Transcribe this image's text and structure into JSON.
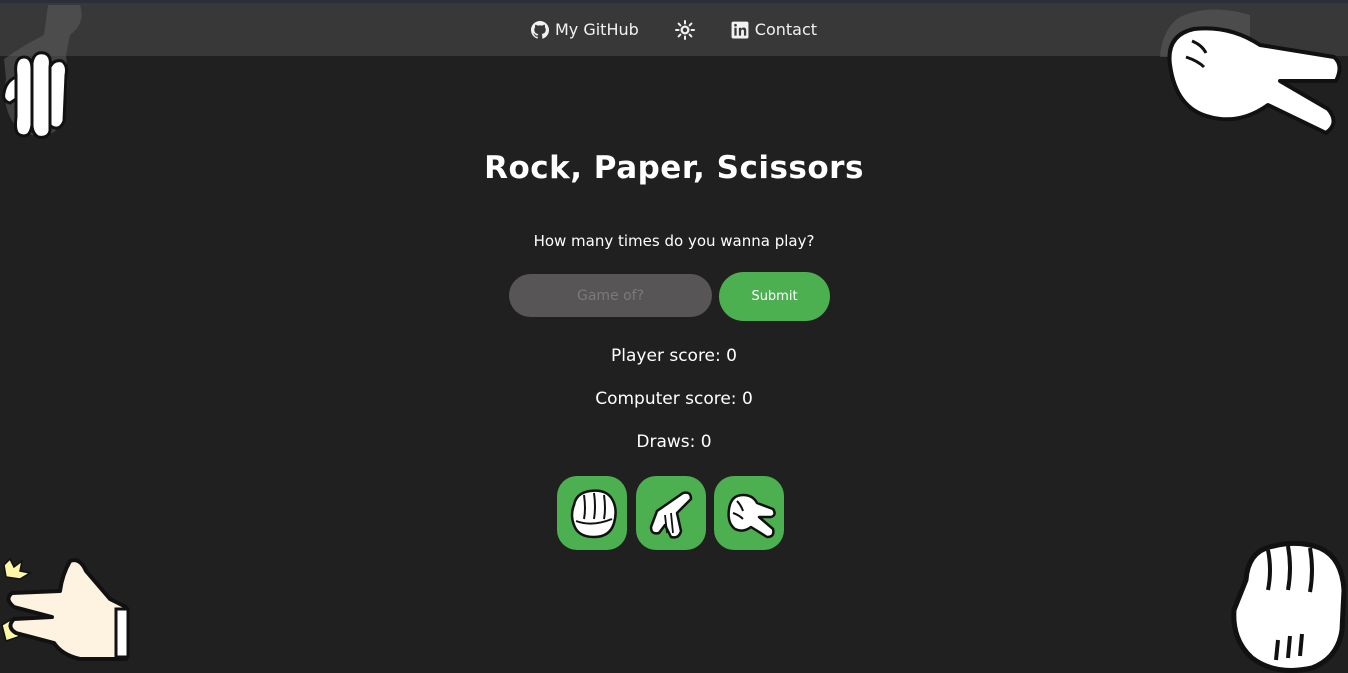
{
  "nav": {
    "github_label": "My GitHub",
    "contact_label": "Contact",
    "github_icon": "github-icon",
    "theme_icon": "sun-icon",
    "contact_icon": "linkedin-icon"
  },
  "game": {
    "title": "Rock, Paper, Scissors",
    "prompt": "How many times do you wanna play?",
    "input_placeholder": "Game of?",
    "input_value": "",
    "submit_label": "Submit"
  },
  "scores": {
    "player": "Player score: 0",
    "computer": "Computer score: 0",
    "draws": "Draws: 0"
  },
  "choices": [
    {
      "name": "rock",
      "icon": "rock-fist-icon"
    },
    {
      "name": "paper",
      "icon": "paper-hand-icon"
    },
    {
      "name": "scissors",
      "icon": "scissors-hand-icon"
    }
  ],
  "colors": {
    "background": "#202020",
    "navbar": "#383838",
    "accent": "#4caf50",
    "input": "#575555"
  }
}
